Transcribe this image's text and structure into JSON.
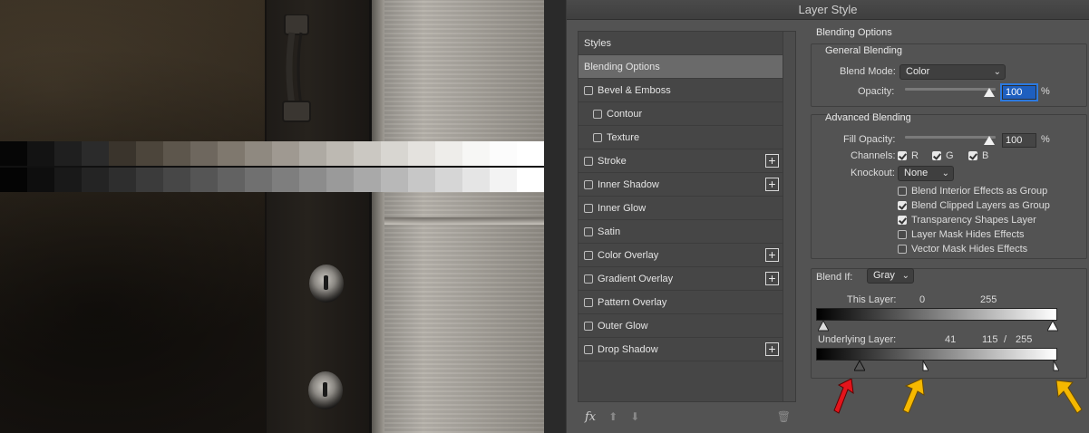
{
  "gray_strip": {
    "top_row": [
      "#060606",
      "#131313",
      "#1f1f1f",
      "#2b2b2b",
      "#3a342c",
      "#4c453b",
      "#5d564c",
      "#6e675e",
      "#7f786e",
      "#8f8980",
      "#9f9991",
      "#aeaaa3",
      "#bdb9b2",
      "#cbc8c2",
      "#d8d6d1",
      "#e4e2de",
      "#eeedea",
      "#f7f7f5",
      "#fcfcfc",
      "#ffffff"
    ],
    "bottom_row": [
      "#040404",
      "#0e0e0e",
      "#191919",
      "#242424",
      "#2e2e2e",
      "#3b3b3b",
      "#474747",
      "#555555",
      "#626262",
      "#707070",
      "#7e7e7e",
      "#8c8c8c",
      "#9a9a9a",
      "#a9a9a9",
      "#b8b8b8",
      "#c7c7c7",
      "#d6d6d6",
      "#e5e5e5",
      "#f3f3f3",
      "#ffffff"
    ]
  },
  "dialog": {
    "title": "Layer Style",
    "styles_list": {
      "header": "Styles",
      "items": [
        {
          "label": "Blending Options",
          "checkbox": false,
          "selected": true,
          "indent": false,
          "plus": false
        },
        {
          "label": "Bevel & Emboss",
          "checkbox": true,
          "checked": false,
          "indent": false,
          "plus": false
        },
        {
          "label": "Contour",
          "checkbox": true,
          "checked": false,
          "indent": true,
          "plus": false
        },
        {
          "label": "Texture",
          "checkbox": true,
          "checked": false,
          "indent": true,
          "plus": false
        },
        {
          "label": "Stroke",
          "checkbox": true,
          "checked": false,
          "indent": false,
          "plus": true
        },
        {
          "label": "Inner Shadow",
          "checkbox": true,
          "checked": false,
          "indent": false,
          "plus": true
        },
        {
          "label": "Inner Glow",
          "checkbox": true,
          "checked": false,
          "indent": false,
          "plus": false
        },
        {
          "label": "Satin",
          "checkbox": true,
          "checked": false,
          "indent": false,
          "plus": false
        },
        {
          "label": "Color Overlay",
          "checkbox": true,
          "checked": false,
          "indent": false,
          "plus": true
        },
        {
          "label": "Gradient Overlay",
          "checkbox": true,
          "checked": false,
          "indent": false,
          "plus": true
        },
        {
          "label": "Pattern Overlay",
          "checkbox": true,
          "checked": false,
          "indent": false,
          "plus": false
        },
        {
          "label": "Outer Glow",
          "checkbox": true,
          "checked": false,
          "indent": false,
          "plus": false
        },
        {
          "label": "Drop Shadow",
          "checkbox": true,
          "checked": false,
          "indent": false,
          "plus": true
        }
      ],
      "footer": {
        "fx_label": "fx",
        "move_up_icon": "arrow-up-icon",
        "move_down_icon": "arrow-down-icon",
        "trash_icon": "trash-icon"
      }
    },
    "blending": {
      "title": "Blending Options",
      "general": {
        "title": "General Blending",
        "blend_mode_label": "Blend Mode:",
        "blend_mode_value": "Color",
        "opacity_label": "Opacity:",
        "opacity_value": "100",
        "opacity_unit": "%"
      },
      "advanced": {
        "title": "Advanced Blending",
        "fill_opacity_label": "Fill Opacity:",
        "fill_opacity_value": "100",
        "fill_opacity_unit": "%",
        "channels_label": "Channels:",
        "channels": [
          {
            "label": "R",
            "checked": true
          },
          {
            "label": "G",
            "checked": true
          },
          {
            "label": "B",
            "checked": true
          }
        ],
        "knockout_label": "Knockout:",
        "knockout_value": "None",
        "options": [
          {
            "label": "Blend Interior Effects as Group",
            "checked": false
          },
          {
            "label": "Blend Clipped Layers as Group",
            "checked": true
          },
          {
            "label": "Transparency Shapes Layer",
            "checked": true
          },
          {
            "label": "Layer Mask Hides Effects",
            "checked": false
          },
          {
            "label": "Vector Mask Hides Effects",
            "checked": false
          }
        ]
      },
      "blend_if": {
        "label": "Blend If:",
        "channel_value": "Gray",
        "this_layer_label": "This Layer:",
        "this_layer_low": "0",
        "this_layer_high": "255",
        "underlying_label": "Underlying Layer:",
        "underlying_low": "41",
        "underlying_split": "115",
        "underlying_slash": "/",
        "underlying_high": "255"
      }
    }
  },
  "annotations": {
    "red_arrow_color": "#e3141b",
    "yellow_arrow_color": "#f5b800"
  }
}
